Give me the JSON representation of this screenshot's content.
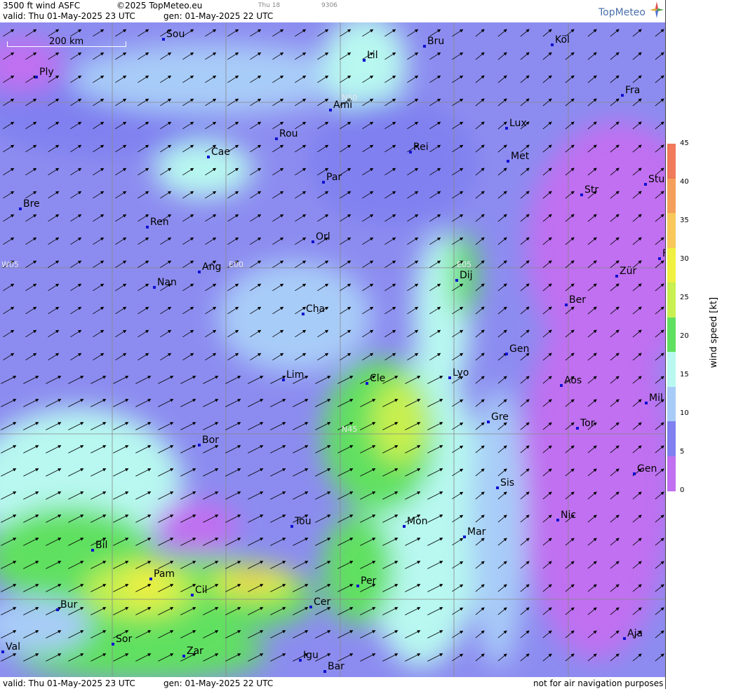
{
  "header": {
    "product": "3500 ft wind ASFC",
    "copyright": "©2025 TopMeteo.eu",
    "valid": "valid:  Thu  01-May-2025  23 UTC",
    "gen": "gen:  01-May-2025 22 UTC",
    "day_small": "Thu 18",
    "code_small": "9306"
  },
  "footer": {
    "valid": "valid:  Thu  01-May-2025  23 UTC",
    "gen": "gen:  01-May-2025 22 UTC",
    "disclaimer": "not for air navigation purposes"
  },
  "logo": {
    "text": "TopMeteo",
    "icon": "compass-star-icon"
  },
  "scale": {
    "label": "200 km"
  },
  "legend": {
    "unit": "wind  speed  [kt]",
    "ticks": [
      "45",
      "40",
      "35",
      "30",
      "25",
      "20",
      "15",
      "10",
      "5",
      "0"
    ],
    "colors": [
      "#f07a5a",
      "#f5a05a",
      "#f8c85a",
      "#f0f040",
      "#c8f050",
      "#60e060",
      "#b8f8f0",
      "#a8ccf8",
      "#8080f0",
      "#c070f0"
    ]
  },
  "grid_labels": {
    "n50": "N50",
    "n45": "N45",
    "e00": "E00",
    "e05": "E05",
    "w05": "W05"
  },
  "cities": {
    "sou": "Sou",
    "ply": "Ply",
    "lil": "Lil",
    "bru": "Bru",
    "kol": "Köl",
    "ami": "Ami",
    "fra": "Fra",
    "rou": "Rou",
    "lux": "Lux",
    "cae": "Cae",
    "rei": "Rei",
    "met": "Met",
    "par": "Par",
    "stu": "Stu",
    "bre": "Bre",
    "str": "Str",
    "ren": "Ren",
    "orl": "Orl",
    "dij": "Dij",
    "zur": "Zür",
    "ang": "Ang",
    "nan": "Nan",
    "ber": "Ber",
    "cha": "Cha",
    "gen1": "Gen",
    "lim": "Lim",
    "cle": "Cle",
    "lyo": "Lyo",
    "aos": "Aos",
    "mil": "Mil",
    "gre": "Gre",
    "tor": "Tor",
    "bor": "Bor",
    "gen2": "Gen",
    "sis": "Sis",
    "tou": "Tou",
    "mon": "Mon",
    "nic": "Nic",
    "mar": "Mar",
    "bil": "Bil",
    "pam": "Pam",
    "per": "Per",
    "cil": "Cil",
    "bur": "Bur",
    "cer": "Cer",
    "sor": "Sor",
    "aja": "Aja",
    "val": "Val",
    "zar": "Zar",
    "igu": "Igu",
    "bar": "Bar",
    "f_edge": "F"
  }
}
